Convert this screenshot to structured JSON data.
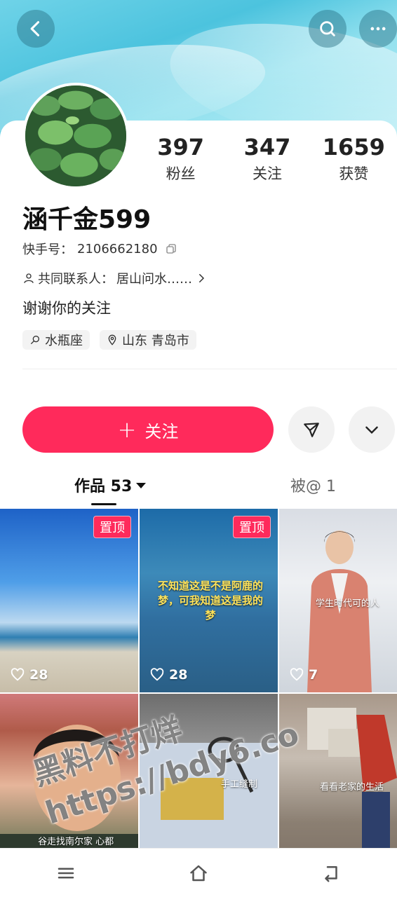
{
  "profile": {
    "name": "涵千金599",
    "kuaishou_id_label": "快手号：",
    "kuaishou_id": "2106662180",
    "mutual_contacts_label": "共同联系人：",
    "mutual_contacts": "居山问水……",
    "bio": "谢谢你的关注",
    "tags": [
      {
        "icon": "search-icon",
        "label": "水瓶座"
      },
      {
        "icon": "location-icon",
        "label": "山东 青岛市"
      }
    ]
  },
  "stats": [
    {
      "value": "397",
      "label": "粉丝"
    },
    {
      "value": "347",
      "label": "关注"
    },
    {
      "value": "1659",
      "label": "获赞"
    }
  ],
  "actions": {
    "follow_label": "关注",
    "follow_plus": "+"
  },
  "tabs": {
    "works_label": "作品 53",
    "mentioned_label": "被@ 1"
  },
  "videos": [
    {
      "pinned": "置顶",
      "likes": "28"
    },
    {
      "pinned": "置顶",
      "likes": "28",
      "caption": "不知道这是不是阿鹿的梦，可我知道这是我的梦"
    },
    {
      "likes": "7",
      "caption": "学生时代可的人"
    },
    {
      "caption": "谷走找南尔家 心都留了一样"
    },
    {
      "caption": "手工缝制"
    },
    {
      "caption": "看看老家的生活"
    }
  ],
  "watermark": {
    "line1": "黑料不打烊",
    "line2": "https://bdy6.co"
  },
  "colors": {
    "accent": "#ff2a5b",
    "banner": "#4cc3de"
  }
}
